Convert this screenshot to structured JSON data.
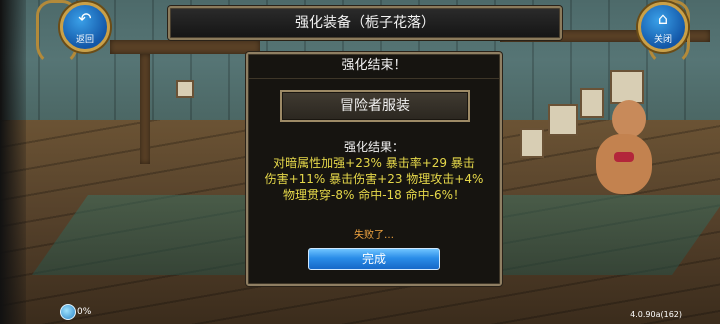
{
  "header": {
    "title": "强化装备（栀子花落）",
    "back_label": "返回",
    "close_label": "关闭"
  },
  "dialog": {
    "title": "强化结束！",
    "item_name": "冒险者服装",
    "result_header": "强化结果：",
    "result_lines": [
      "对暗属性加强+23% 暴击率+29 暴击",
      "伤害+11% 暴击伤害+23 物理攻击+4%",
      "物理贯穿-8% 命中-18 命中-6%！"
    ],
    "fail_text": "失败了…",
    "done_label": "完成"
  },
  "status": {
    "progress_text": "0%",
    "version": "4.0.90a(162)"
  },
  "icons": {
    "back": "back-arrow-icon",
    "close": "home-icon",
    "status": "loading-globe-icon"
  },
  "colors": {
    "result_text": "#e6d84a",
    "fail_text": "#f0a440",
    "button_blue": "#2a8de8",
    "frame_gold": "#caa047"
  }
}
